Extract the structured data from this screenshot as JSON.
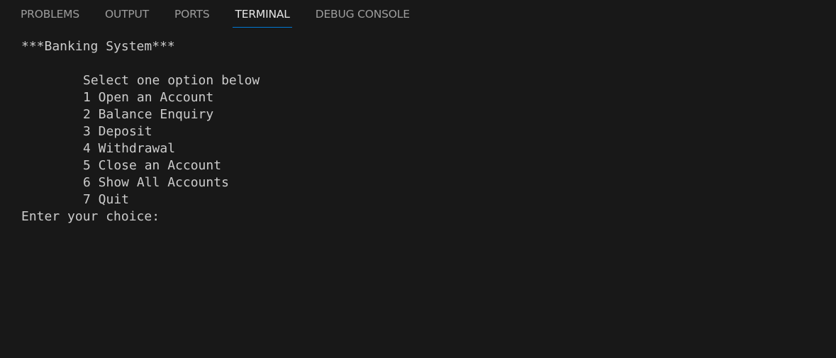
{
  "panel": {
    "tabs": [
      {
        "label": "PROBLEMS",
        "active": false
      },
      {
        "label": "OUTPUT",
        "active": false
      },
      {
        "label": "PORTS",
        "active": false
      },
      {
        "label": "TERMINAL",
        "active": true
      },
      {
        "label": "DEBUG CONSOLE",
        "active": false
      }
    ]
  },
  "terminal": {
    "title_line": "***Banking System***",
    "menu_heading": "Select one option below",
    "options": [
      "1 Open an Account",
      "2 Balance Enquiry",
      "3 Deposit",
      "4 Withdrawal",
      "5 Close an Account",
      "6 Show All Accounts",
      "7 Quit"
    ],
    "prompt": "Enter your choice:"
  },
  "colors": {
    "background": "#181818",
    "terminal_text": "#cccccc",
    "tab_inactive": "#9d9d9d",
    "tab_active": "#e7e7e7",
    "accent_underline": "#0078d4"
  }
}
